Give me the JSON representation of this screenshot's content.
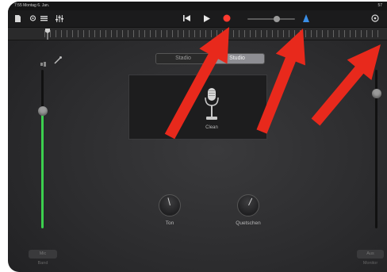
{
  "status_bar": {
    "time": "7:55",
    "date": "Montag 6. Jan.",
    "battery": "57"
  },
  "toolbar": {
    "icons": [
      "document-icon",
      "loop-browser-icon",
      "mixer-icon",
      "settings-sliders-icon",
      "rewind-icon",
      "play-icon",
      "record-icon",
      "master-volume-icon",
      "metronome-icon",
      "settings-icon"
    ],
    "record_color": "#ff3b30",
    "metronome_color": "#3a8ee6"
  },
  "segment": {
    "left_label": "Stadio",
    "right_label": "Studio",
    "selected": "Studio"
  },
  "amp": {
    "preset_label": "Clean"
  },
  "knobs": [
    {
      "label": "Ton"
    },
    {
      "label": "Quetschen"
    }
  ],
  "input_level": {
    "fraction": 0.74,
    "label": "Mic",
    "sublabel": "Band"
  },
  "master_level": {
    "fraction": 0.85,
    "label": "Aus",
    "sublabel": "Monitor"
  },
  "annotations": {
    "arrow_color": "#e8291c"
  }
}
